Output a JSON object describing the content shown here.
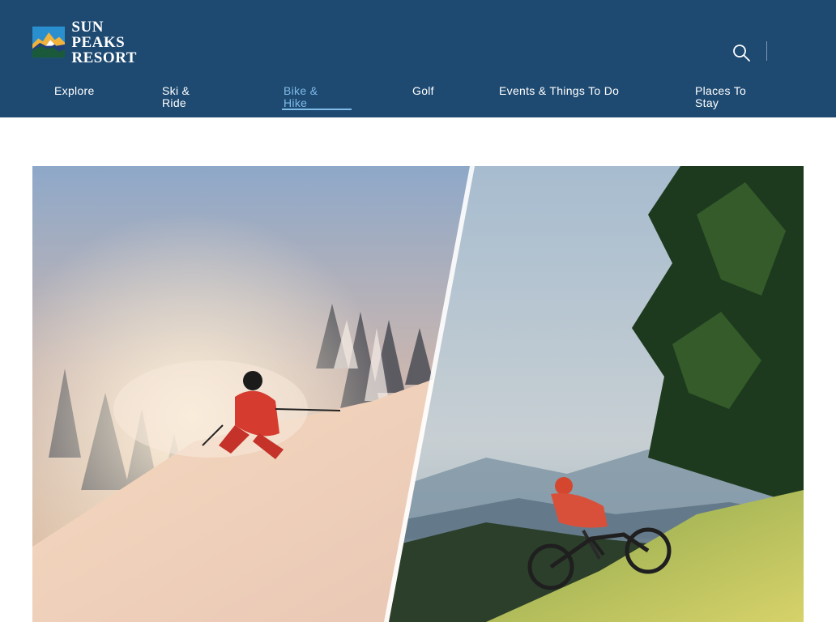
{
  "brand": {
    "name_line1": "SUN PEAKS",
    "name_line2": "RESORT",
    "trademark": "®"
  },
  "header": {
    "search_icon": "search-icon",
    "colors": {
      "background": "#1e4a72",
      "active": "#7fbbe8",
      "text": "#ffffff"
    }
  },
  "nav": {
    "items": [
      {
        "label": "Explore",
        "active": false
      },
      {
        "label": "Ski & Ride",
        "active": false
      },
      {
        "label": "Bike & Hike",
        "active": true
      },
      {
        "label": "Golf",
        "active": false
      },
      {
        "label": "Events & Things To Do",
        "active": false
      },
      {
        "label": "Places To Stay",
        "active": false
      }
    ]
  },
  "hero": {
    "image": "split-photo-skier-and-mountain-biker"
  }
}
